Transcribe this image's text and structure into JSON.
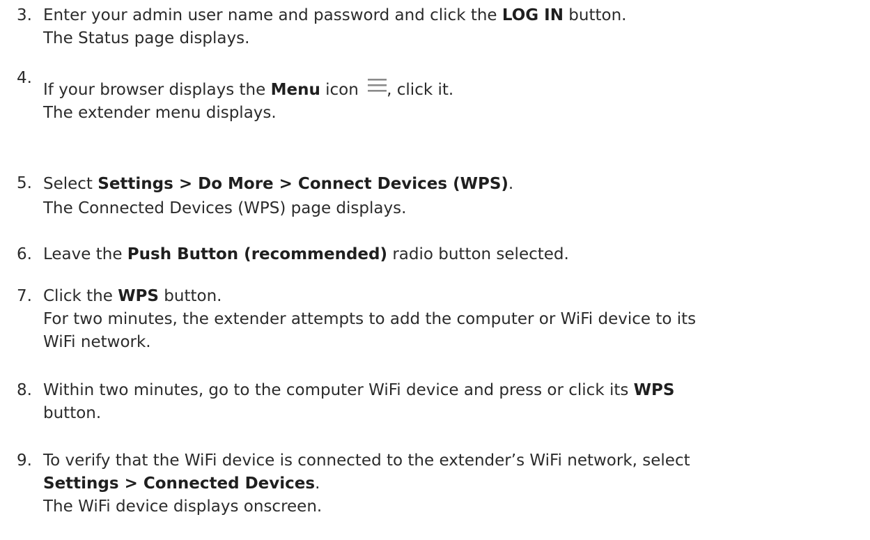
{
  "steps": [
    {
      "number": "3.",
      "lines": [
        {
          "pre": "Enter your admin user name and password and click the ",
          "bold": "LOG IN",
          "post": " button."
        },
        {
          "text": "The Status page displays."
        }
      ]
    },
    {
      "number": "4.",
      "lines": [
        {
          "pre": "If your browser displays the ",
          "bold": "Menu",
          "mid": " icon ",
          "icon": "menu-icon",
          "post": ", click it."
        },
        {
          "text": "The extender menu displays."
        }
      ]
    },
    {
      "number": "5.",
      "lines": [
        {
          "pre": "Select ",
          "bold": "Settings > Do More > Connect Devices (WPS)",
          "post": "."
        },
        {
          "text": "The Connected Devices (WPS) page displays."
        }
      ]
    },
    {
      "number": "6.",
      "lines": [
        {
          "pre": "Leave the ",
          "bold": "Push Button (recommended)",
          "post": " radio button selected."
        }
      ]
    },
    {
      "number": "7.",
      "lines": [
        {
          "pre": "Click the ",
          "bold": "WPS",
          "post": " button."
        },
        {
          "text": "For two minutes, the extender attempts to add the computer or WiFi device to its"
        },
        {
          "text": "WiFi network."
        }
      ]
    },
    {
      "number": "8.",
      "lines": [
        {
          "pre": "Within two minutes, go to the computer WiFi device and press or click its ",
          "bold": "WPS"
        },
        {
          "text": "button."
        }
      ]
    },
    {
      "number": "9.",
      "lines": [
        {
          "text": "To verify that the WiFi device is connected to the extender’s WiFi network, select"
        },
        {
          "bold": "Settings > Connected Devices",
          "post": "."
        },
        {
          "text": "The WiFi device displays onscreen."
        }
      ]
    }
  ]
}
